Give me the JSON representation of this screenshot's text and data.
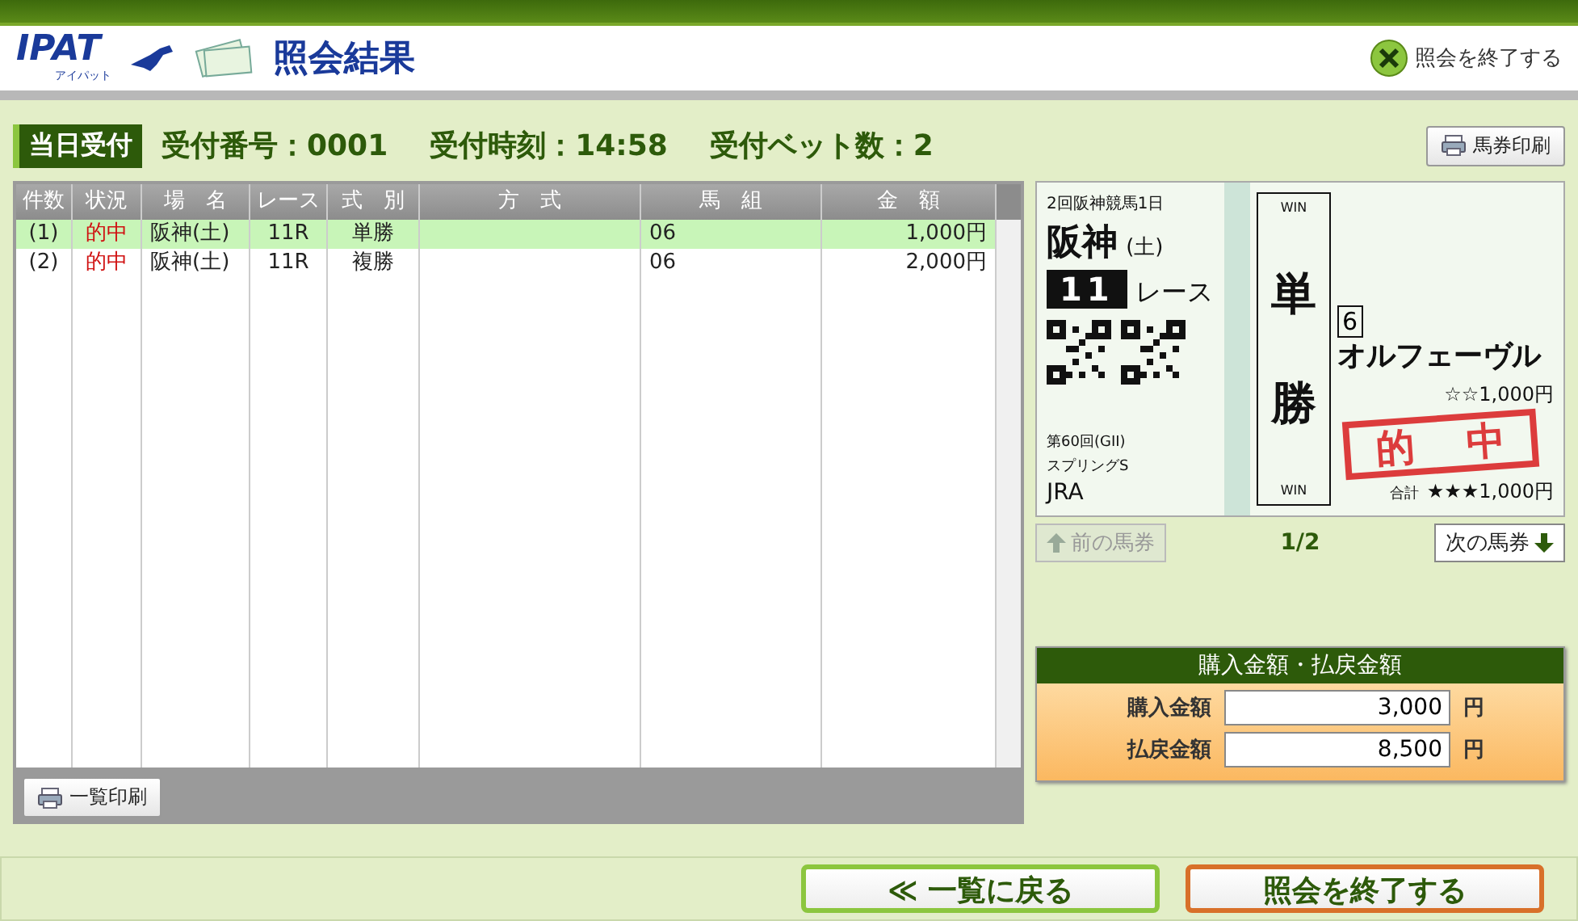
{
  "header": {
    "logo": "IPAT",
    "logo_sub": "アイパット",
    "title": "照会結果",
    "close_button": "照会を終了する"
  },
  "info": {
    "badge": "当日受付",
    "items": [
      "受付番号：0001",
      "受付時刻：14:58",
      "受付ベット数：2"
    ],
    "print_button": "馬券印刷"
  },
  "table": {
    "columns": [
      "件数",
      "状況",
      "場　名",
      "レース",
      "式　別",
      "方　式",
      "馬　組",
      "金　額"
    ],
    "rows": [
      {
        "selected": true,
        "cells": [
          "(1)",
          "的中",
          "阪神(土)",
          "11R",
          "単勝",
          "",
          "06",
          "1,000円"
        ]
      },
      {
        "selected": false,
        "cells": [
          "(2)",
          "的中",
          "阪神(土)",
          "11R",
          "複勝",
          "",
          "06",
          "2,000円"
        ]
      }
    ],
    "print_button": "一覧印刷"
  },
  "ticket": {
    "meeting": "2回阪神競馬1日",
    "venue": "阪神",
    "day": "(土)",
    "race_no": "11",
    "race_label": "レース",
    "race_name_1": "第60回(GII)",
    "race_name_2": "スプリングS",
    "issuer": "JRA",
    "win_top": "WIN",
    "bet_type_1": "単",
    "bet_type_2": "勝",
    "win_bottom": "WIN",
    "horse_no": "6",
    "horse_name": "オルフェーヴル",
    "stake": "☆☆1,000円",
    "total_label": "合計",
    "total": "★★★1,000円",
    "stamp_1": "的",
    "stamp_2": "中"
  },
  "ticket_nav": {
    "prev": {
      "label": "前の馬券",
      "disabled": true
    },
    "page": "1/2",
    "next": {
      "label": "次の馬券",
      "disabled": false
    }
  },
  "amounts": {
    "title": "購入金額・払戻金額",
    "rows": [
      {
        "label": "購入金額",
        "value": "3,000",
        "unit": "円"
      },
      {
        "label": "払戻金額",
        "value": "8,500",
        "unit": "円"
      }
    ]
  },
  "footer": {
    "back_button": "≪ 一覧に戻る",
    "end_button": "照会を終了する"
  }
}
